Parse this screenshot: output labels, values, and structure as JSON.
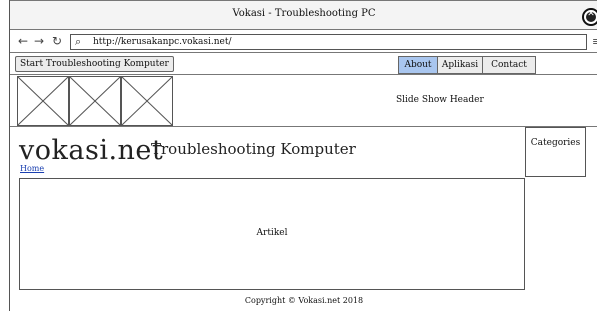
{
  "window": {
    "title": "Vokasi - Troubleshooting PC"
  },
  "browser": {
    "url": "http://kerusakanpc.vokasi.net/",
    "icons": {
      "back": "arrow-left-icon",
      "forward": "arrow-right-icon",
      "refresh": "refresh-icon",
      "search": "search-icon",
      "menu": "hamburger-menu-icon",
      "close": "close-icon"
    }
  },
  "toolbar": {
    "start_label": "Start Troubleshooting Komputer",
    "tabs": [
      {
        "label": "About",
        "active": true
      },
      {
        "label": "Aplikasi",
        "active": false
      },
      {
        "label": "Contact",
        "active": false
      }
    ],
    "active_color": "#a9c6ef"
  },
  "slideshow": {
    "label": "Slide Show Header"
  },
  "site": {
    "name": "vokasi.net",
    "tagline": "Troubleshooting Komputer",
    "home_link": "Home"
  },
  "sidebar": {
    "categories_label": "Categories"
  },
  "main": {
    "article_label": "Artikel"
  },
  "footer": {
    "copyright": "Copyright © Vokasi.net 2018"
  }
}
